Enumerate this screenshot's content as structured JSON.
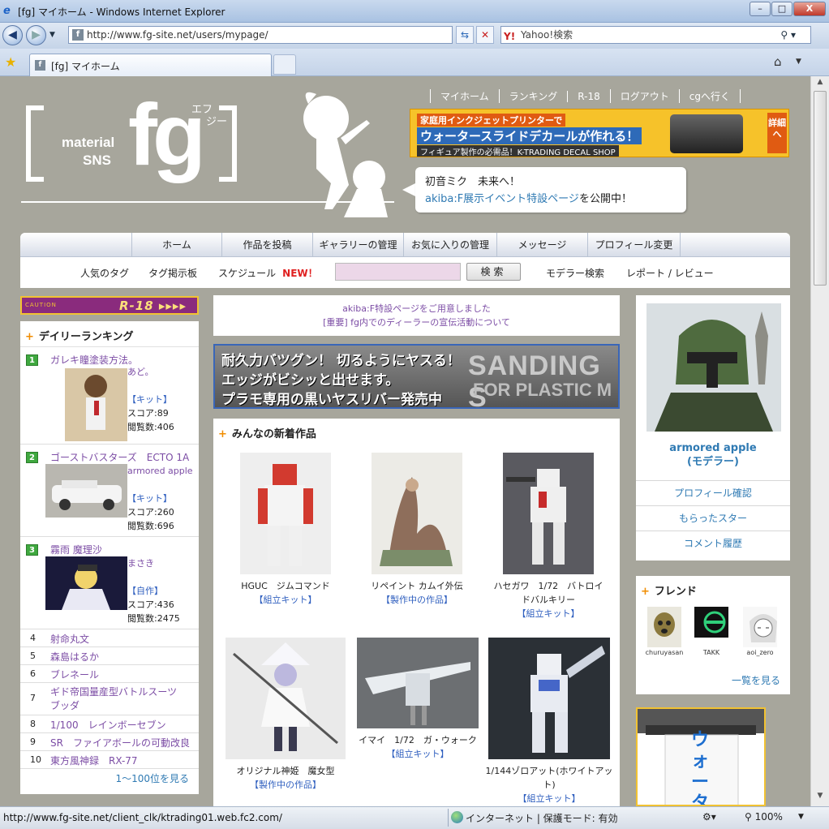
{
  "window": {
    "title": "[fg] マイホーム - Windows Internet Explorer",
    "btn_min": "–",
    "btn_max": "□",
    "btn_close": "X"
  },
  "address": {
    "url": "http://www.fg-site.net/users/mypage/",
    "search_placeholder": "Yahoo!検索",
    "search_brand": "Y!"
  },
  "tabs": {
    "active_label": "[fg] マイホーム"
  },
  "header": {
    "logo_material": "material",
    "logo_sns": "SNS",
    "logo_fg": "fg",
    "logo_furigana_1": "エフ",
    "logo_furigana_2": "ジー",
    "top_links": [
      "マイホーム",
      "ランキング",
      "R-18",
      "ログアウト",
      "cgへ行く"
    ],
    "ad": {
      "line1": "家庭用インクジェットプリンターで",
      "line2": "ウォータースライドデカールが作れる！",
      "line3": "フィギュア製作の必需品！K-TRADING DECAL SHOP",
      "detail": "詳細へ"
    },
    "bubble_line1": "初音ミク　未来へ！",
    "bubble_link": "akiba:F展示イベント特設ページ",
    "bubble_suffix": "を公開中！"
  },
  "nav": {
    "row1": [
      "ホーム",
      "作品を投稿",
      "ギャラリーの管理",
      "お気に入りの管理",
      "メッセージ",
      "プロフィール変更"
    ],
    "popular_tags": "人気のタグ",
    "tag_board": "タグ掲示板",
    "schedule": "スケジュール",
    "new_badge": "NEW！",
    "search_button": "検索",
    "modeler_search": "モデラー検索",
    "report_review": "レポート / レビュー"
  },
  "r18": {
    "caution": "CAUTION",
    "label": "R-18 ▸▸▸▸"
  },
  "daily_ranking": {
    "heading": "デイリーランキング",
    "top": [
      {
        "rank": "1",
        "title": "ガレキ瞳塗装方法。",
        "user": "あど。",
        "category": "【キット】",
        "score": "スコア:89",
        "views": "閲覧数:406"
      },
      {
        "rank": "2",
        "title": "ゴーストバスターズ　ECTO 1A",
        "user": "armored apple",
        "category": "【キット】",
        "score": "スコア:260",
        "views": "閲覧数:696"
      },
      {
        "rank": "3",
        "title": "霧雨 魔理沙",
        "user": "まさき",
        "category": "【自作】",
        "score": "スコア:436",
        "views": "閲覧数:2475"
      }
    ],
    "rest": [
      {
        "num": "4",
        "label": "射命丸文"
      },
      {
        "num": "5",
        "label": "森島はるか"
      },
      {
        "num": "6",
        "label": "ブレネール"
      },
      {
        "num": "7",
        "label": "ギド帝国量産型バトルスーツ　ブッダ"
      },
      {
        "num": "8",
        "label": "1/100　レインボーセブン"
      },
      {
        "num": "9",
        "label": "SR　ファイアボールの可動改良"
      },
      {
        "num": "10",
        "label": "東方風神録　RX-77"
      }
    ],
    "more": "1～100位を見る"
  },
  "mid": {
    "notice1": "akiba:F特設ページをご用意しました",
    "notice2": "[重要]  fg内でのディーラーの宣伝活動について",
    "banner_line1": "耐久力バツグン！ 切るようにヤスる！",
    "banner_line2": "エッジがビシッと出せます。",
    "banner_line3": "プラモ専用の黒いヤスリバー発売中",
    "banner_bg1": "SANDING S",
    "banner_bg2": "FOR PLASTIC M",
    "works_heading": "みんなの新着作品",
    "works": [
      {
        "title": "HGUC　ジムコマンド",
        "category": "【組立キット】"
      },
      {
        "title": "リペイント カムイ外伝",
        "category": "【製作中の作品】"
      },
      {
        "title": "ハセガワ　1/72　バトロイドバルキリー",
        "category": "【組立キット】"
      },
      {
        "title": "オリジナル神姫　魔女型",
        "category": "【製作中の作品】"
      },
      {
        "title": "イマイ　1/72　ガ・ウォーク",
        "category": "【組立キット】"
      },
      {
        "title": "1/144ゾロアット(ホワイトアット)",
        "category": "【組立キット】"
      }
    ]
  },
  "profile": {
    "name": "armored apple",
    "role": "(モデラー)",
    "links": [
      "プロフィール確認",
      "もらったスター",
      "コメント履歴"
    ]
  },
  "friends": {
    "heading": "フレンド",
    "list": [
      "churuyasan",
      "TAKK",
      "aoi_zero"
    ],
    "more": "一覧を見る"
  },
  "right_ad": {
    "text": "ウォーター"
  },
  "status": {
    "url": "http://www.fg-site.net/client_clk/ktrading01.web.fc2.com/",
    "zone": "インターネット | 保護モード: 有効",
    "zoom": "100%"
  }
}
